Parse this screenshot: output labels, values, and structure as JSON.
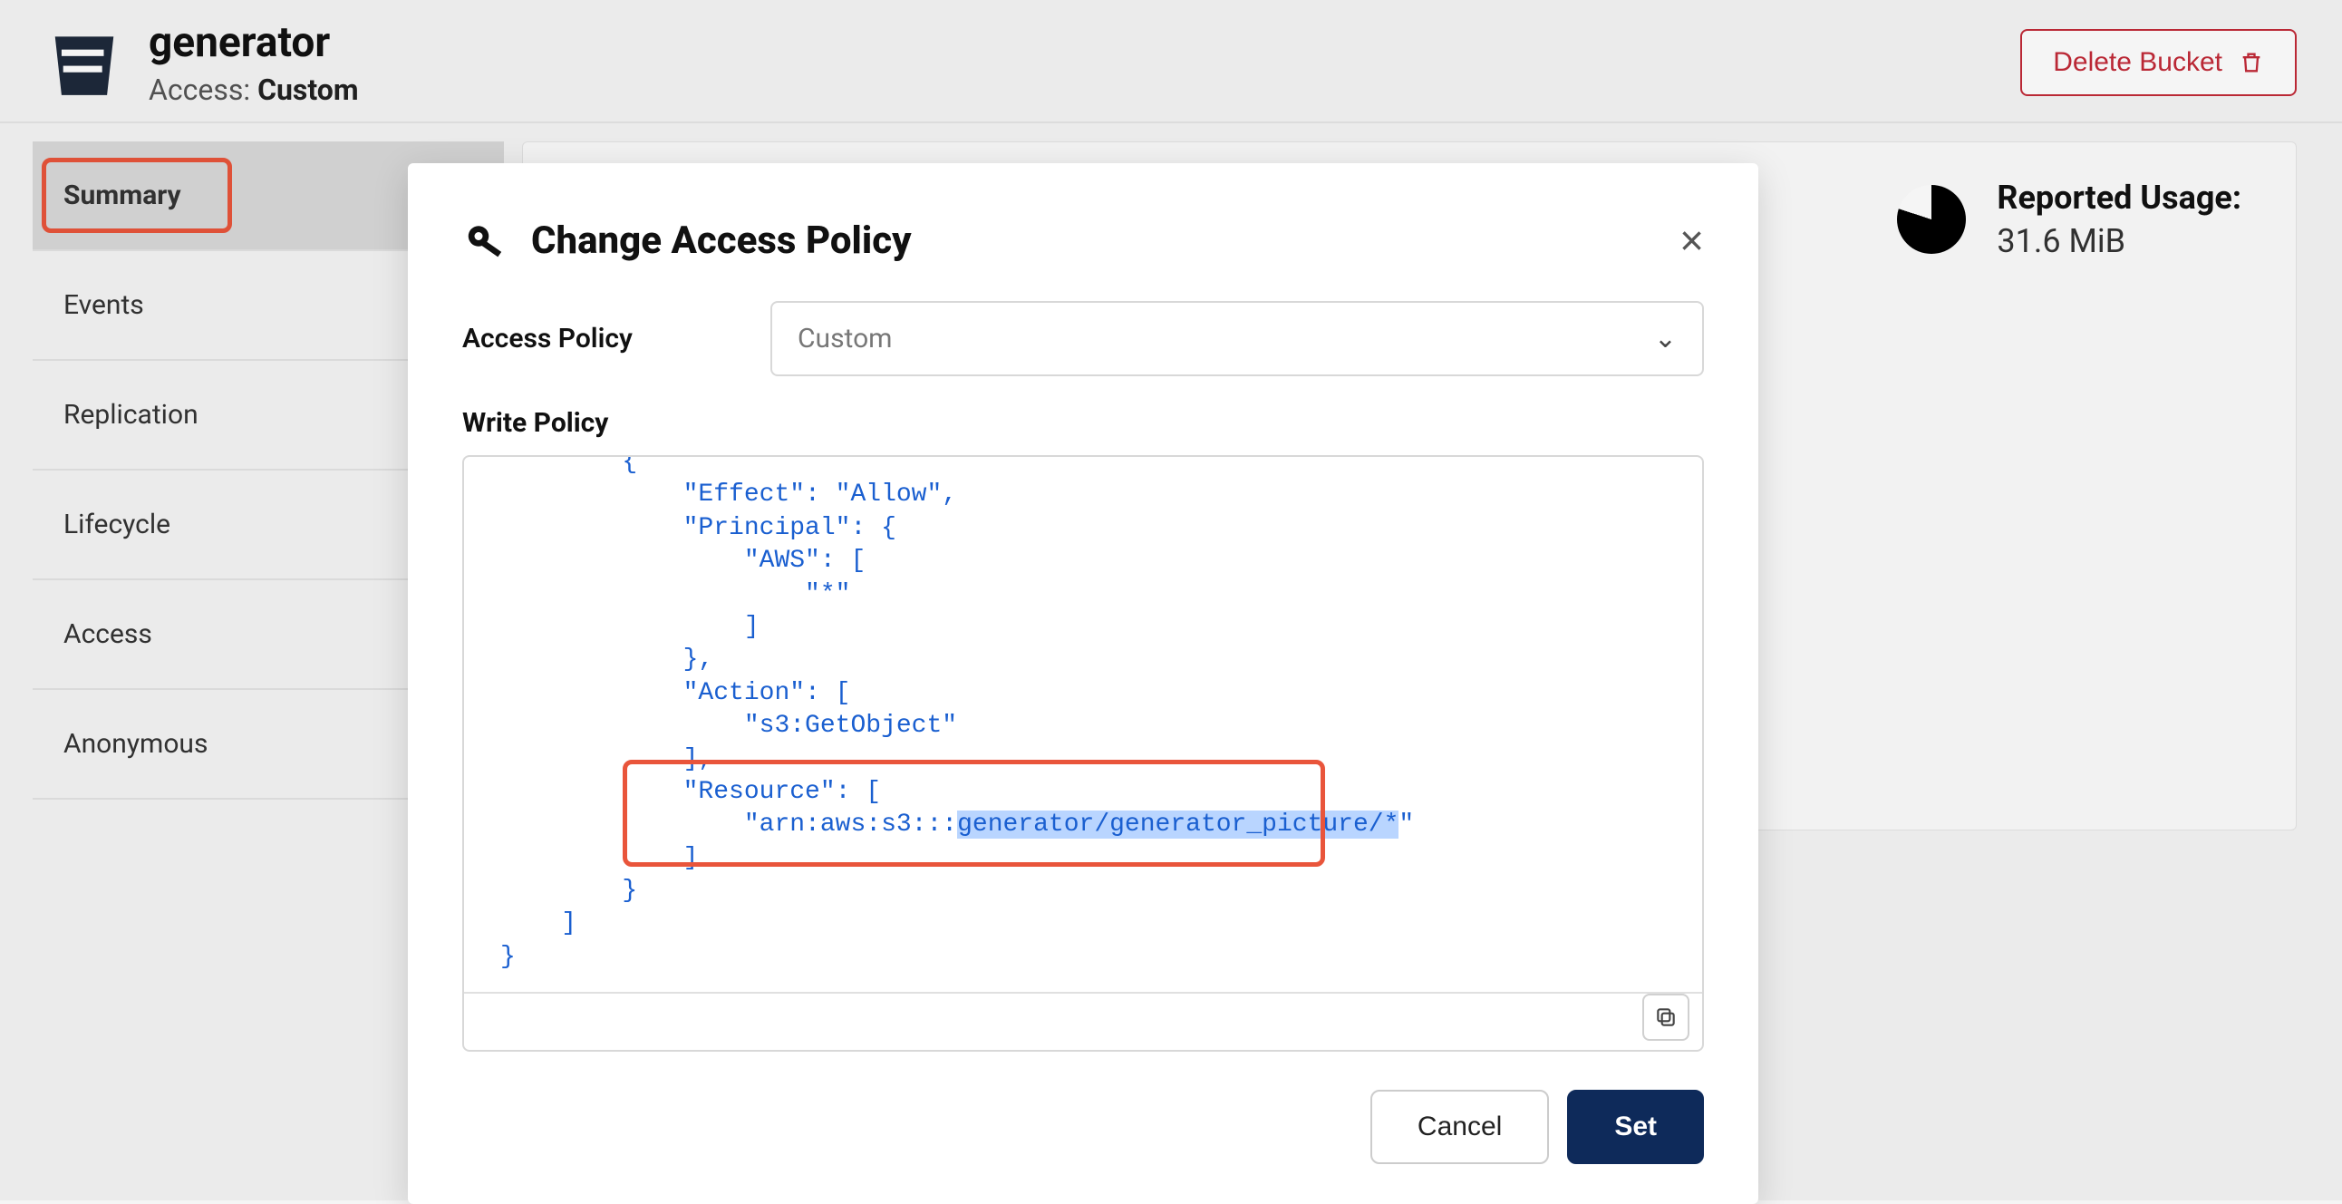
{
  "header": {
    "title": "generator",
    "access_label": "Access:",
    "access_value": "Custom",
    "delete_label": "Delete Bucket"
  },
  "sidebar": {
    "items": [
      {
        "label": "Summary",
        "active": true
      },
      {
        "label": "Events",
        "active": false
      },
      {
        "label": "Replication",
        "active": false
      },
      {
        "label": "Lifecycle",
        "active": false
      },
      {
        "label": "Access",
        "active": false
      },
      {
        "label": "Anonymous",
        "active": false
      }
    ]
  },
  "usage": {
    "title": "Reported Usage:",
    "value": "31.6 MiB"
  },
  "modal": {
    "title": "Change Access Policy",
    "access_policy_label": "Access Policy",
    "access_policy_value": "Custom",
    "write_policy_label": "Write Policy",
    "policy_lines": [
      "        {",
      "            \"Effect\": \"Allow\",",
      "            \"Principal\": {",
      "                \"AWS\": [",
      "                    \"*\"",
      "                ]",
      "            },",
      "            \"Action\": [",
      "                \"s3:GetObject\"",
      "            ],",
      "            \"Resource\": [",
      "                \"arn:aws:s3:::",
      "generator/generator_picture/*",
      "\"",
      "            ]",
      "        }",
      "    ]",
      "}"
    ],
    "cancel_label": "Cancel",
    "set_label": "Set"
  }
}
